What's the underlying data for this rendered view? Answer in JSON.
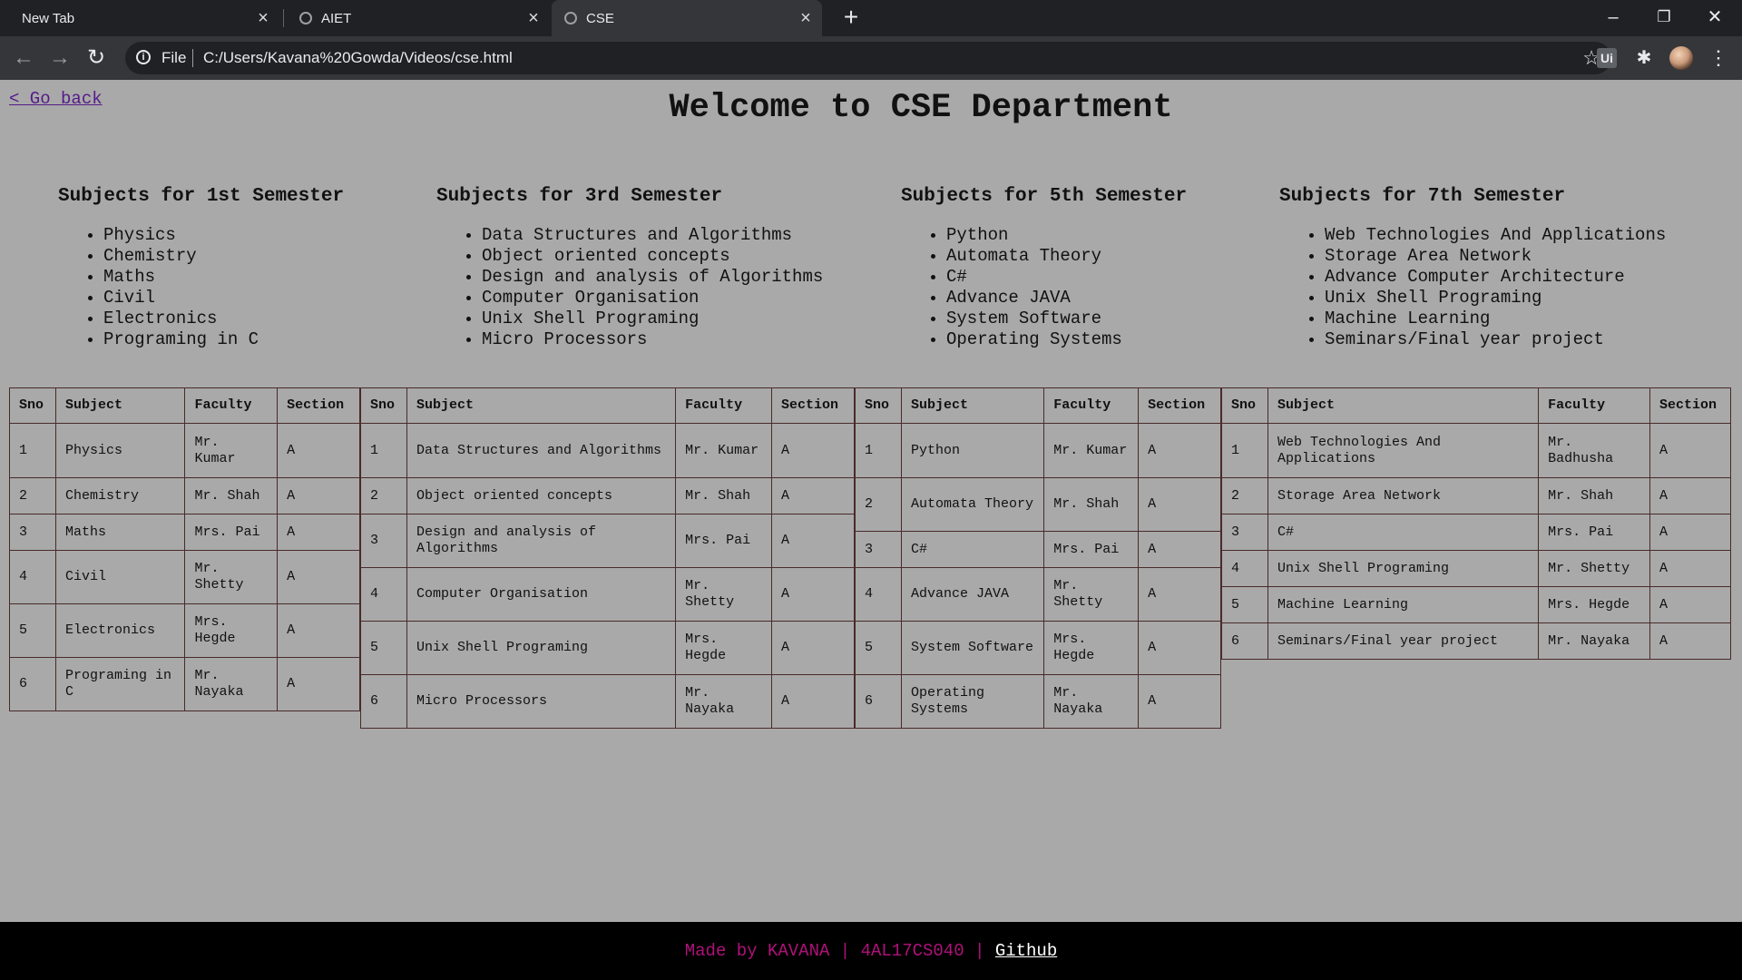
{
  "browser": {
    "tabs": [
      {
        "label": "New Tab"
      },
      {
        "label": "AIET"
      },
      {
        "label": "CSE"
      }
    ],
    "omnibox": {
      "scheme": "File",
      "url": "C:/Users/Kavana%20Gowda/Videos/cse.html"
    },
    "extension_label": "Ui"
  },
  "page": {
    "go_back": "< Go back",
    "heading": "Welcome to CSE Department",
    "semesters": [
      {
        "title": "Subjects for 1st Semester",
        "subjects": [
          "Physics",
          "Chemistry",
          "Maths",
          "Civil",
          "Electronics",
          "Programing in C"
        ]
      },
      {
        "title": "Subjects for 3rd Semester",
        "subjects": [
          "Data Structures and Algorithms",
          "Object oriented concepts",
          "Design and analysis of Algorithms",
          "Computer Organisation",
          "Unix Shell Programing",
          "Micro Processors"
        ]
      },
      {
        "title": "Subjects for 5th Semester",
        "subjects": [
          "Python",
          "Automata Theory",
          "C#",
          "Advance JAVA",
          "System Software",
          "Operating Systems"
        ]
      },
      {
        "title": "Subjects for 7th Semester",
        "subjects": [
          "Web Technologies And Applications",
          "Storage Area Network",
          "Advance Computer Architecture",
          "Unix Shell Programing",
          "Machine Learning",
          "Seminars/Final year project"
        ]
      }
    ],
    "table_headers": [
      "Sno",
      "Subject",
      "Faculty",
      "Section"
    ],
    "tables": [
      {
        "rows": [
          [
            "1",
            "Physics",
            "Mr. Kumar",
            "A"
          ],
          [
            "2",
            "Chemistry",
            "Mr. Shah",
            "A"
          ],
          [
            "3",
            "Maths",
            "Mrs. Pai",
            "A"
          ],
          [
            "4",
            "Civil",
            "Mr. Shetty",
            "A"
          ],
          [
            "5",
            "Electronics",
            "Mrs. Hegde",
            "A"
          ],
          [
            "6",
            "Programing in C",
            "Mr. Nayaka",
            "A"
          ]
        ]
      },
      {
        "rows": [
          [
            "1",
            "Data Structures and Algorithms",
            "Mr. Kumar",
            "A"
          ],
          [
            "2",
            "Object oriented concepts",
            "Mr. Shah",
            "A"
          ],
          [
            "3",
            "Design and analysis of Algorithms",
            "Mrs. Pai",
            "A"
          ],
          [
            "4",
            "Computer Organisation",
            "Mr. Shetty",
            "A"
          ],
          [
            "5",
            "Unix Shell Programing",
            "Mrs. Hegde",
            "A"
          ],
          [
            "6",
            "Micro Processors",
            "Mr. Nayaka",
            "A"
          ]
        ]
      },
      {
        "rows": [
          [
            "1",
            "Python",
            "Mr. Kumar",
            "A"
          ],
          [
            "2",
            "Automata Theory",
            "Mr. Shah",
            "A"
          ],
          [
            "3",
            "C#",
            "Mrs. Pai",
            "A"
          ],
          [
            "4",
            "Advance JAVA",
            "Mr. Shetty",
            "A"
          ],
          [
            "5",
            "System Software",
            "Mrs. Hegde",
            "A"
          ],
          [
            "6",
            "Operating Systems",
            "Mr. Nayaka",
            "A"
          ]
        ]
      },
      {
        "rows": [
          [
            "1",
            "Web Technologies And Applications",
            "Mr. Badhusha",
            "A"
          ],
          [
            "2",
            "Storage Area Network",
            "Mr. Shah",
            "A"
          ],
          [
            "3",
            "C#",
            "Mrs. Pai",
            "A"
          ],
          [
            "4",
            "Unix Shell Programing",
            "Mr. Shetty",
            "A"
          ],
          [
            "5",
            "Machine Learning",
            "Mrs. Hegde",
            "A"
          ],
          [
            "6",
            "Seminars/Final year project",
            "Mr. Nayaka",
            "A"
          ]
        ]
      }
    ],
    "footer": {
      "text": "Made by KAVANA | 4AL17CS040 | ",
      "link": "Github"
    }
  }
}
